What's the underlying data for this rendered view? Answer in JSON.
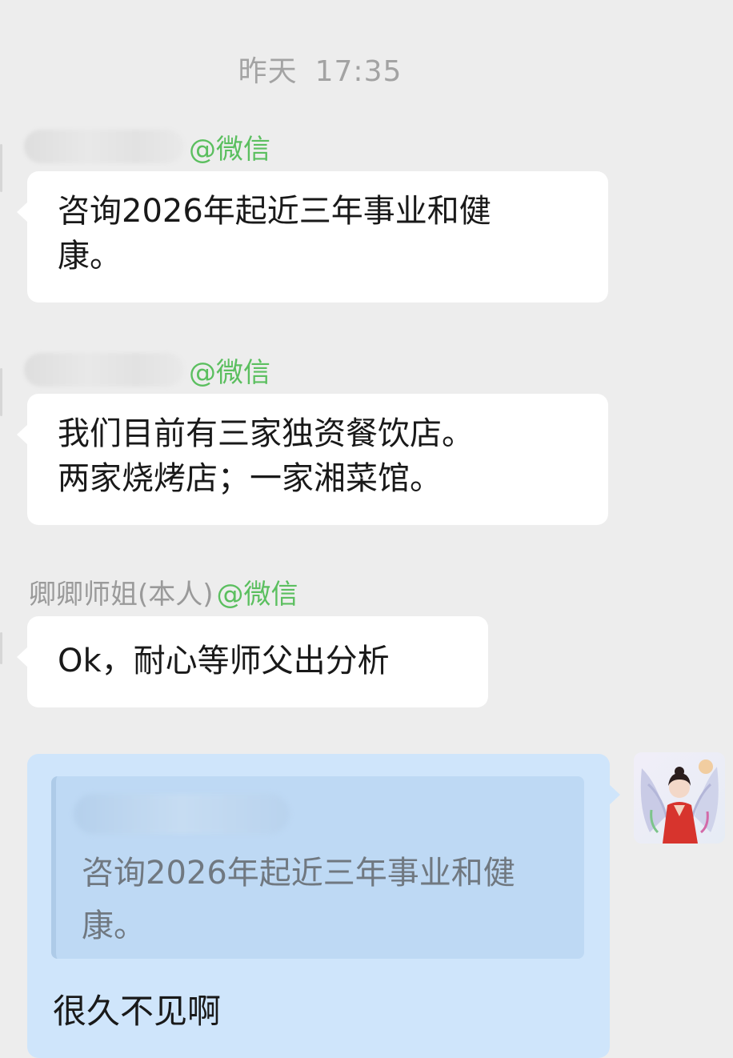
{
  "timestamp": {
    "day": "昨天",
    "time": "17:35"
  },
  "messages": [
    {
      "sender_name": "",
      "sender_tag": "@微信",
      "text_lines": [
        "咨询2026年起近三年事业和健",
        "康。"
      ]
    },
    {
      "sender_name": "",
      "sender_tag": "@微信",
      "text_lines": [
        "我们目前有三家独资餐饮店。",
        "两家烧烤店；一家湘菜馆。"
      ]
    },
    {
      "sender_name": "卿卿师姐(本人)",
      "sender_tag": "@微信",
      "text_lines": [
        "Ok，耐心等师父出分析"
      ]
    }
  ],
  "self_message": {
    "quote_text_lines": [
      "咨询2026年起近三年事业和健",
      "康。"
    ],
    "text": "很久不见啊"
  },
  "colors": {
    "background": "#ededed",
    "incoming_bubble": "#ffffff",
    "outgoing_bubble": "#cfe5fb",
    "wechat_tag": "#5bbf5f"
  },
  "icons": {
    "avatar": "avatar-icon"
  }
}
